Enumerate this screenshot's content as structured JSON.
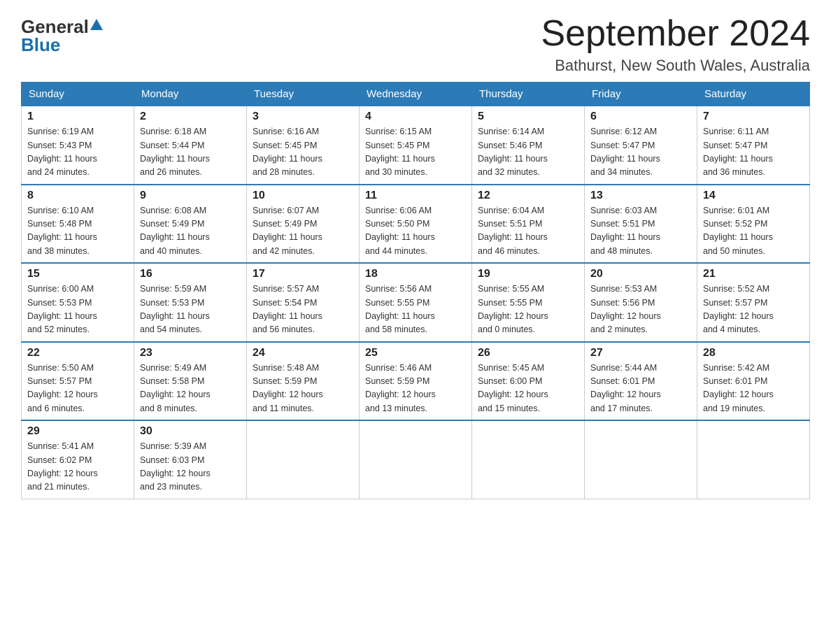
{
  "logo": {
    "general": "General",
    "blue": "Blue"
  },
  "title": "September 2024",
  "subtitle": "Bathurst, New South Wales, Australia",
  "days_of_week": [
    "Sunday",
    "Monday",
    "Tuesday",
    "Wednesday",
    "Thursday",
    "Friday",
    "Saturday"
  ],
  "weeks": [
    [
      {
        "day": "1",
        "sunrise": "6:19 AM",
        "sunset": "5:43 PM",
        "daylight": "11 hours and 24 minutes."
      },
      {
        "day": "2",
        "sunrise": "6:18 AM",
        "sunset": "5:44 PM",
        "daylight": "11 hours and 26 minutes."
      },
      {
        "day": "3",
        "sunrise": "6:16 AM",
        "sunset": "5:45 PM",
        "daylight": "11 hours and 28 minutes."
      },
      {
        "day": "4",
        "sunrise": "6:15 AM",
        "sunset": "5:45 PM",
        "daylight": "11 hours and 30 minutes."
      },
      {
        "day": "5",
        "sunrise": "6:14 AM",
        "sunset": "5:46 PM",
        "daylight": "11 hours and 32 minutes."
      },
      {
        "day": "6",
        "sunrise": "6:12 AM",
        "sunset": "5:47 PM",
        "daylight": "11 hours and 34 minutes."
      },
      {
        "day": "7",
        "sunrise": "6:11 AM",
        "sunset": "5:47 PM",
        "daylight": "11 hours and 36 minutes."
      }
    ],
    [
      {
        "day": "8",
        "sunrise": "6:10 AM",
        "sunset": "5:48 PM",
        "daylight": "11 hours and 38 minutes."
      },
      {
        "day": "9",
        "sunrise": "6:08 AM",
        "sunset": "5:49 PM",
        "daylight": "11 hours and 40 minutes."
      },
      {
        "day": "10",
        "sunrise": "6:07 AM",
        "sunset": "5:49 PM",
        "daylight": "11 hours and 42 minutes."
      },
      {
        "day": "11",
        "sunrise": "6:06 AM",
        "sunset": "5:50 PM",
        "daylight": "11 hours and 44 minutes."
      },
      {
        "day": "12",
        "sunrise": "6:04 AM",
        "sunset": "5:51 PM",
        "daylight": "11 hours and 46 minutes."
      },
      {
        "day": "13",
        "sunrise": "6:03 AM",
        "sunset": "5:51 PM",
        "daylight": "11 hours and 48 minutes."
      },
      {
        "day": "14",
        "sunrise": "6:01 AM",
        "sunset": "5:52 PM",
        "daylight": "11 hours and 50 minutes."
      }
    ],
    [
      {
        "day": "15",
        "sunrise": "6:00 AM",
        "sunset": "5:53 PM",
        "daylight": "11 hours and 52 minutes."
      },
      {
        "day": "16",
        "sunrise": "5:59 AM",
        "sunset": "5:53 PM",
        "daylight": "11 hours and 54 minutes."
      },
      {
        "day": "17",
        "sunrise": "5:57 AM",
        "sunset": "5:54 PM",
        "daylight": "11 hours and 56 minutes."
      },
      {
        "day": "18",
        "sunrise": "5:56 AM",
        "sunset": "5:55 PM",
        "daylight": "11 hours and 58 minutes."
      },
      {
        "day": "19",
        "sunrise": "5:55 AM",
        "sunset": "5:55 PM",
        "daylight": "12 hours and 0 minutes."
      },
      {
        "day": "20",
        "sunrise": "5:53 AM",
        "sunset": "5:56 PM",
        "daylight": "12 hours and 2 minutes."
      },
      {
        "day": "21",
        "sunrise": "5:52 AM",
        "sunset": "5:57 PM",
        "daylight": "12 hours and 4 minutes."
      }
    ],
    [
      {
        "day": "22",
        "sunrise": "5:50 AM",
        "sunset": "5:57 PM",
        "daylight": "12 hours and 6 minutes."
      },
      {
        "day": "23",
        "sunrise": "5:49 AM",
        "sunset": "5:58 PM",
        "daylight": "12 hours and 8 minutes."
      },
      {
        "day": "24",
        "sunrise": "5:48 AM",
        "sunset": "5:59 PM",
        "daylight": "12 hours and 11 minutes."
      },
      {
        "day": "25",
        "sunrise": "5:46 AM",
        "sunset": "5:59 PM",
        "daylight": "12 hours and 13 minutes."
      },
      {
        "day": "26",
        "sunrise": "5:45 AM",
        "sunset": "6:00 PM",
        "daylight": "12 hours and 15 minutes."
      },
      {
        "day": "27",
        "sunrise": "5:44 AM",
        "sunset": "6:01 PM",
        "daylight": "12 hours and 17 minutes."
      },
      {
        "day": "28",
        "sunrise": "5:42 AM",
        "sunset": "6:01 PM",
        "daylight": "12 hours and 19 minutes."
      }
    ],
    [
      {
        "day": "29",
        "sunrise": "5:41 AM",
        "sunset": "6:02 PM",
        "daylight": "12 hours and 21 minutes."
      },
      {
        "day": "30",
        "sunrise": "5:39 AM",
        "sunset": "6:03 PM",
        "daylight": "12 hours and 23 minutes."
      },
      null,
      null,
      null,
      null,
      null
    ]
  ],
  "labels": {
    "sunrise": "Sunrise:",
    "sunset": "Sunset:",
    "daylight": "Daylight:"
  }
}
